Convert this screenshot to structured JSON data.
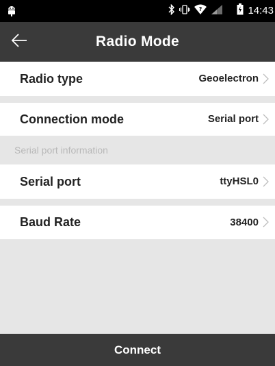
{
  "status_bar": {
    "time": "14:43",
    "icons": [
      "android-debug-icon",
      "bluetooth-icon",
      "vibrate-icon",
      "wifi-icon",
      "cell-signal-icon",
      "battery-icon"
    ]
  },
  "app_bar": {
    "title": "Radio Mode",
    "back_icon": "back-arrow-icon"
  },
  "settings": {
    "radio_type": {
      "label": "Radio type",
      "value": "Geoelectron"
    },
    "connection_mode": {
      "label": "Connection mode",
      "value": "Serial port"
    },
    "section_header": "Serial port information",
    "serial_port": {
      "label": "Serial port",
      "value": "ttyHSL0"
    },
    "baud_rate": {
      "label": "Baud Rate",
      "value": "38400"
    }
  },
  "bottom": {
    "connect_label": "Connect"
  },
  "colors": {
    "status_bar": "#000000",
    "app_bar": "#3a3a3a",
    "background": "#e6e6e6",
    "row": "#ffffff",
    "section_text": "#b8b8b8"
  }
}
